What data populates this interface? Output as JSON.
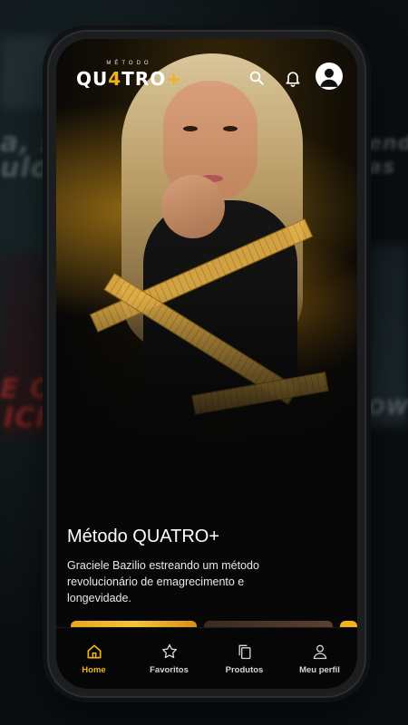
{
  "brand": {
    "small": "MÉTODO",
    "name_a": "QU",
    "name_accent": "4",
    "name_b": "TRO",
    "name_plus": "+"
  },
  "header": {
    "icons": [
      "search-icon",
      "bell-icon",
      "user-avatar-icon"
    ]
  },
  "background": {
    "left_text_1": "a, sou",
    "left_text_2": "ulo Co",
    "left_text_3": "E OF",
    "left_text_4": "ICR",
    "right_text_1": "endo",
    "right_text_2": "as",
    "right_text_3": "OW"
  },
  "content": {
    "title": "Método QUATRO+",
    "description": "Graciele Bazilio estreando um método revolucionário de emagrecimento e longevidade."
  },
  "nav": {
    "items": [
      {
        "label": "Home",
        "icon": "home-icon",
        "active": true
      },
      {
        "label": "Favoritos",
        "icon": "star-icon",
        "active": false
      },
      {
        "label": "Produtos",
        "icon": "copy-icon",
        "active": false
      },
      {
        "label": "Meu perfil",
        "icon": "profile-icon",
        "active": false
      }
    ]
  },
  "colors": {
    "accent": "#f2b21c",
    "background": "#070707",
    "text": "#ffffff"
  }
}
